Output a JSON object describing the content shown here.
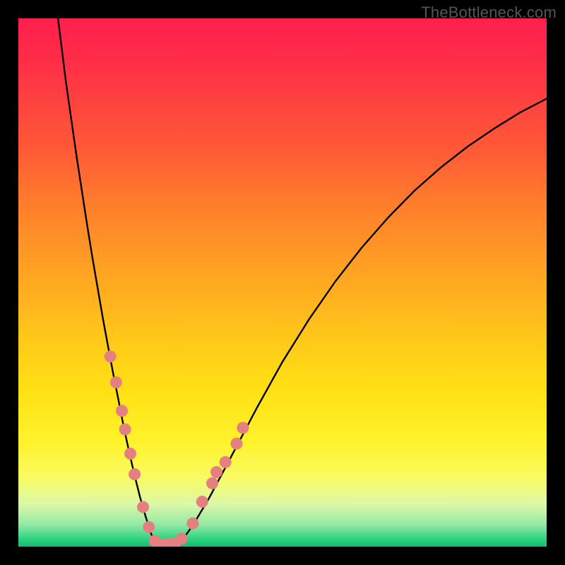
{
  "watermark": {
    "text": "TheBottleneck.com"
  },
  "chart_data": {
    "type": "line",
    "title": "",
    "xlabel": "",
    "ylabel": "",
    "xlim": [
      0,
      1
    ],
    "ylim": [
      0,
      1
    ],
    "gradient_legend": {
      "top_color": "#ff1f4e",
      "top_meaning": "bad",
      "bottom_color": "#14ba75",
      "bottom_meaning": "good"
    },
    "series": [
      {
        "name": "left-curve",
        "x": [
          0.075,
          0.09,
          0.1,
          0.11,
          0.12,
          0.13,
          0.14,
          0.15,
          0.16,
          0.17,
          0.18,
          0.19,
          0.2,
          0.21,
          0.22,
          0.23,
          0.24,
          0.25,
          0.257
        ],
        "y": [
          1.0,
          0.88,
          0.81,
          0.74,
          0.675,
          0.61,
          0.548,
          0.49,
          0.432,
          0.378,
          0.325,
          0.275,
          0.224,
          0.178,
          0.135,
          0.095,
          0.06,
          0.028,
          0.01
        ]
      },
      {
        "name": "valley-floor",
        "x": [
          0.257,
          0.265,
          0.278,
          0.29,
          0.3,
          0.31
        ],
        "y": [
          0.01,
          0.004,
          0.001,
          0.002,
          0.005,
          0.012
        ]
      },
      {
        "name": "right-curve",
        "x": [
          0.31,
          0.33,
          0.36,
          0.4,
          0.45,
          0.5,
          0.55,
          0.6,
          0.65,
          0.7,
          0.75,
          0.8,
          0.85,
          0.9,
          0.95,
          1.0
        ],
        "y": [
          0.012,
          0.04,
          0.09,
          0.165,
          0.26,
          0.35,
          0.43,
          0.502,
          0.566,
          0.623,
          0.674,
          0.718,
          0.757,
          0.791,
          0.822,
          0.848
        ]
      }
    ],
    "markers": {
      "name": "pink-dots",
      "color": "#e58080",
      "points": [
        {
          "x": 0.174,
          "y": 0.36
        },
        {
          "x": 0.185,
          "y": 0.311
        },
        {
          "x": 0.196,
          "y": 0.257
        },
        {
          "x": 0.202,
          "y": 0.222
        },
        {
          "x": 0.212,
          "y": 0.176
        },
        {
          "x": 0.22,
          "y": 0.137
        },
        {
          "x": 0.236,
          "y": 0.075
        },
        {
          "x": 0.247,
          "y": 0.037
        },
        {
          "x": 0.258,
          "y": 0.011
        },
        {
          "x": 0.27,
          "y": 0.003
        },
        {
          "x": 0.283,
          "y": 0.005
        },
        {
          "x": 0.296,
          "y": 0.006
        },
        {
          "x": 0.309,
          "y": 0.015
        },
        {
          "x": 0.33,
          "y": 0.044
        },
        {
          "x": 0.348,
          "y": 0.085
        },
        {
          "x": 0.367,
          "y": 0.12
        },
        {
          "x": 0.375,
          "y": 0.141
        },
        {
          "x": 0.392,
          "y": 0.16
        },
        {
          "x": 0.413,
          "y": 0.195
        },
        {
          "x": 0.425,
          "y": 0.225
        }
      ]
    }
  }
}
